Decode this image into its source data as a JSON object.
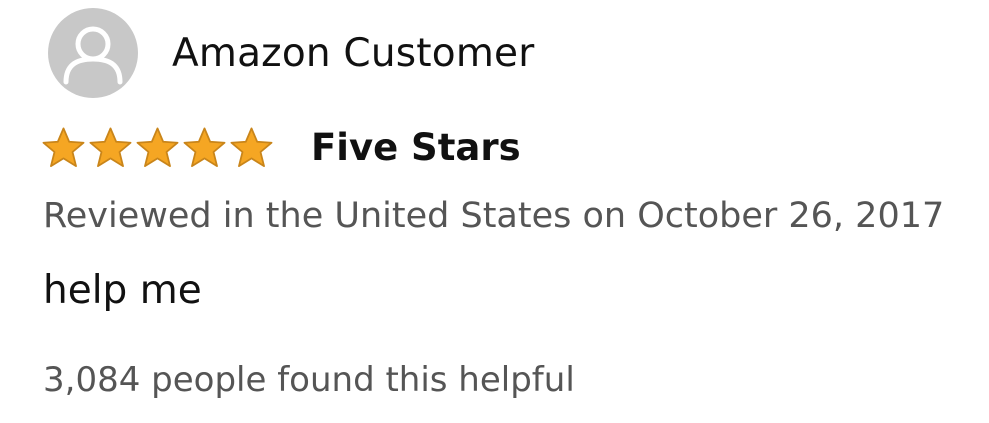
{
  "review": {
    "author": {
      "name": "Amazon Customer",
      "avatar_icon": "default-user-avatar-icon"
    },
    "rating": {
      "stars": 5,
      "max_stars": 5,
      "star_color": "#f5a623",
      "star_icon": "star-icon"
    },
    "title": "Five Stars",
    "meta": "Reviewed in the United States on October 26, 2017",
    "body": "help me",
    "helpful_text": "3,084 people found this helpful"
  }
}
